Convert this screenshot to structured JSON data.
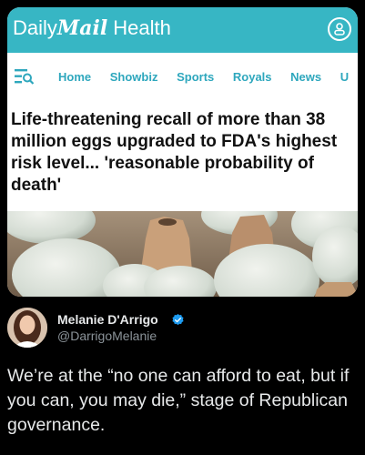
{
  "dm": {
    "brand_daily": "Daily",
    "brand_mail": "Mail",
    "brand_section": "Health",
    "nav": [
      "Home",
      "Showbiz",
      "Sports",
      "Royals",
      "News",
      "U"
    ],
    "headline": "Life-threatening recall of more than 38 million eggs upgraded to FDA's highest risk level... 'reasonable probability of death'",
    "accent_color": "#37b6c4"
  },
  "post": {
    "author_name": "Melanie D'Arrigo",
    "handle": "@DarrigoMelanie",
    "text": "We’re at the “no one can afford to eat, but if you can, you may die,” stage of Republican governance."
  },
  "icons": {
    "user": "user-icon",
    "menu": "menu-search-icon",
    "verified": "verified-badge-icon"
  }
}
